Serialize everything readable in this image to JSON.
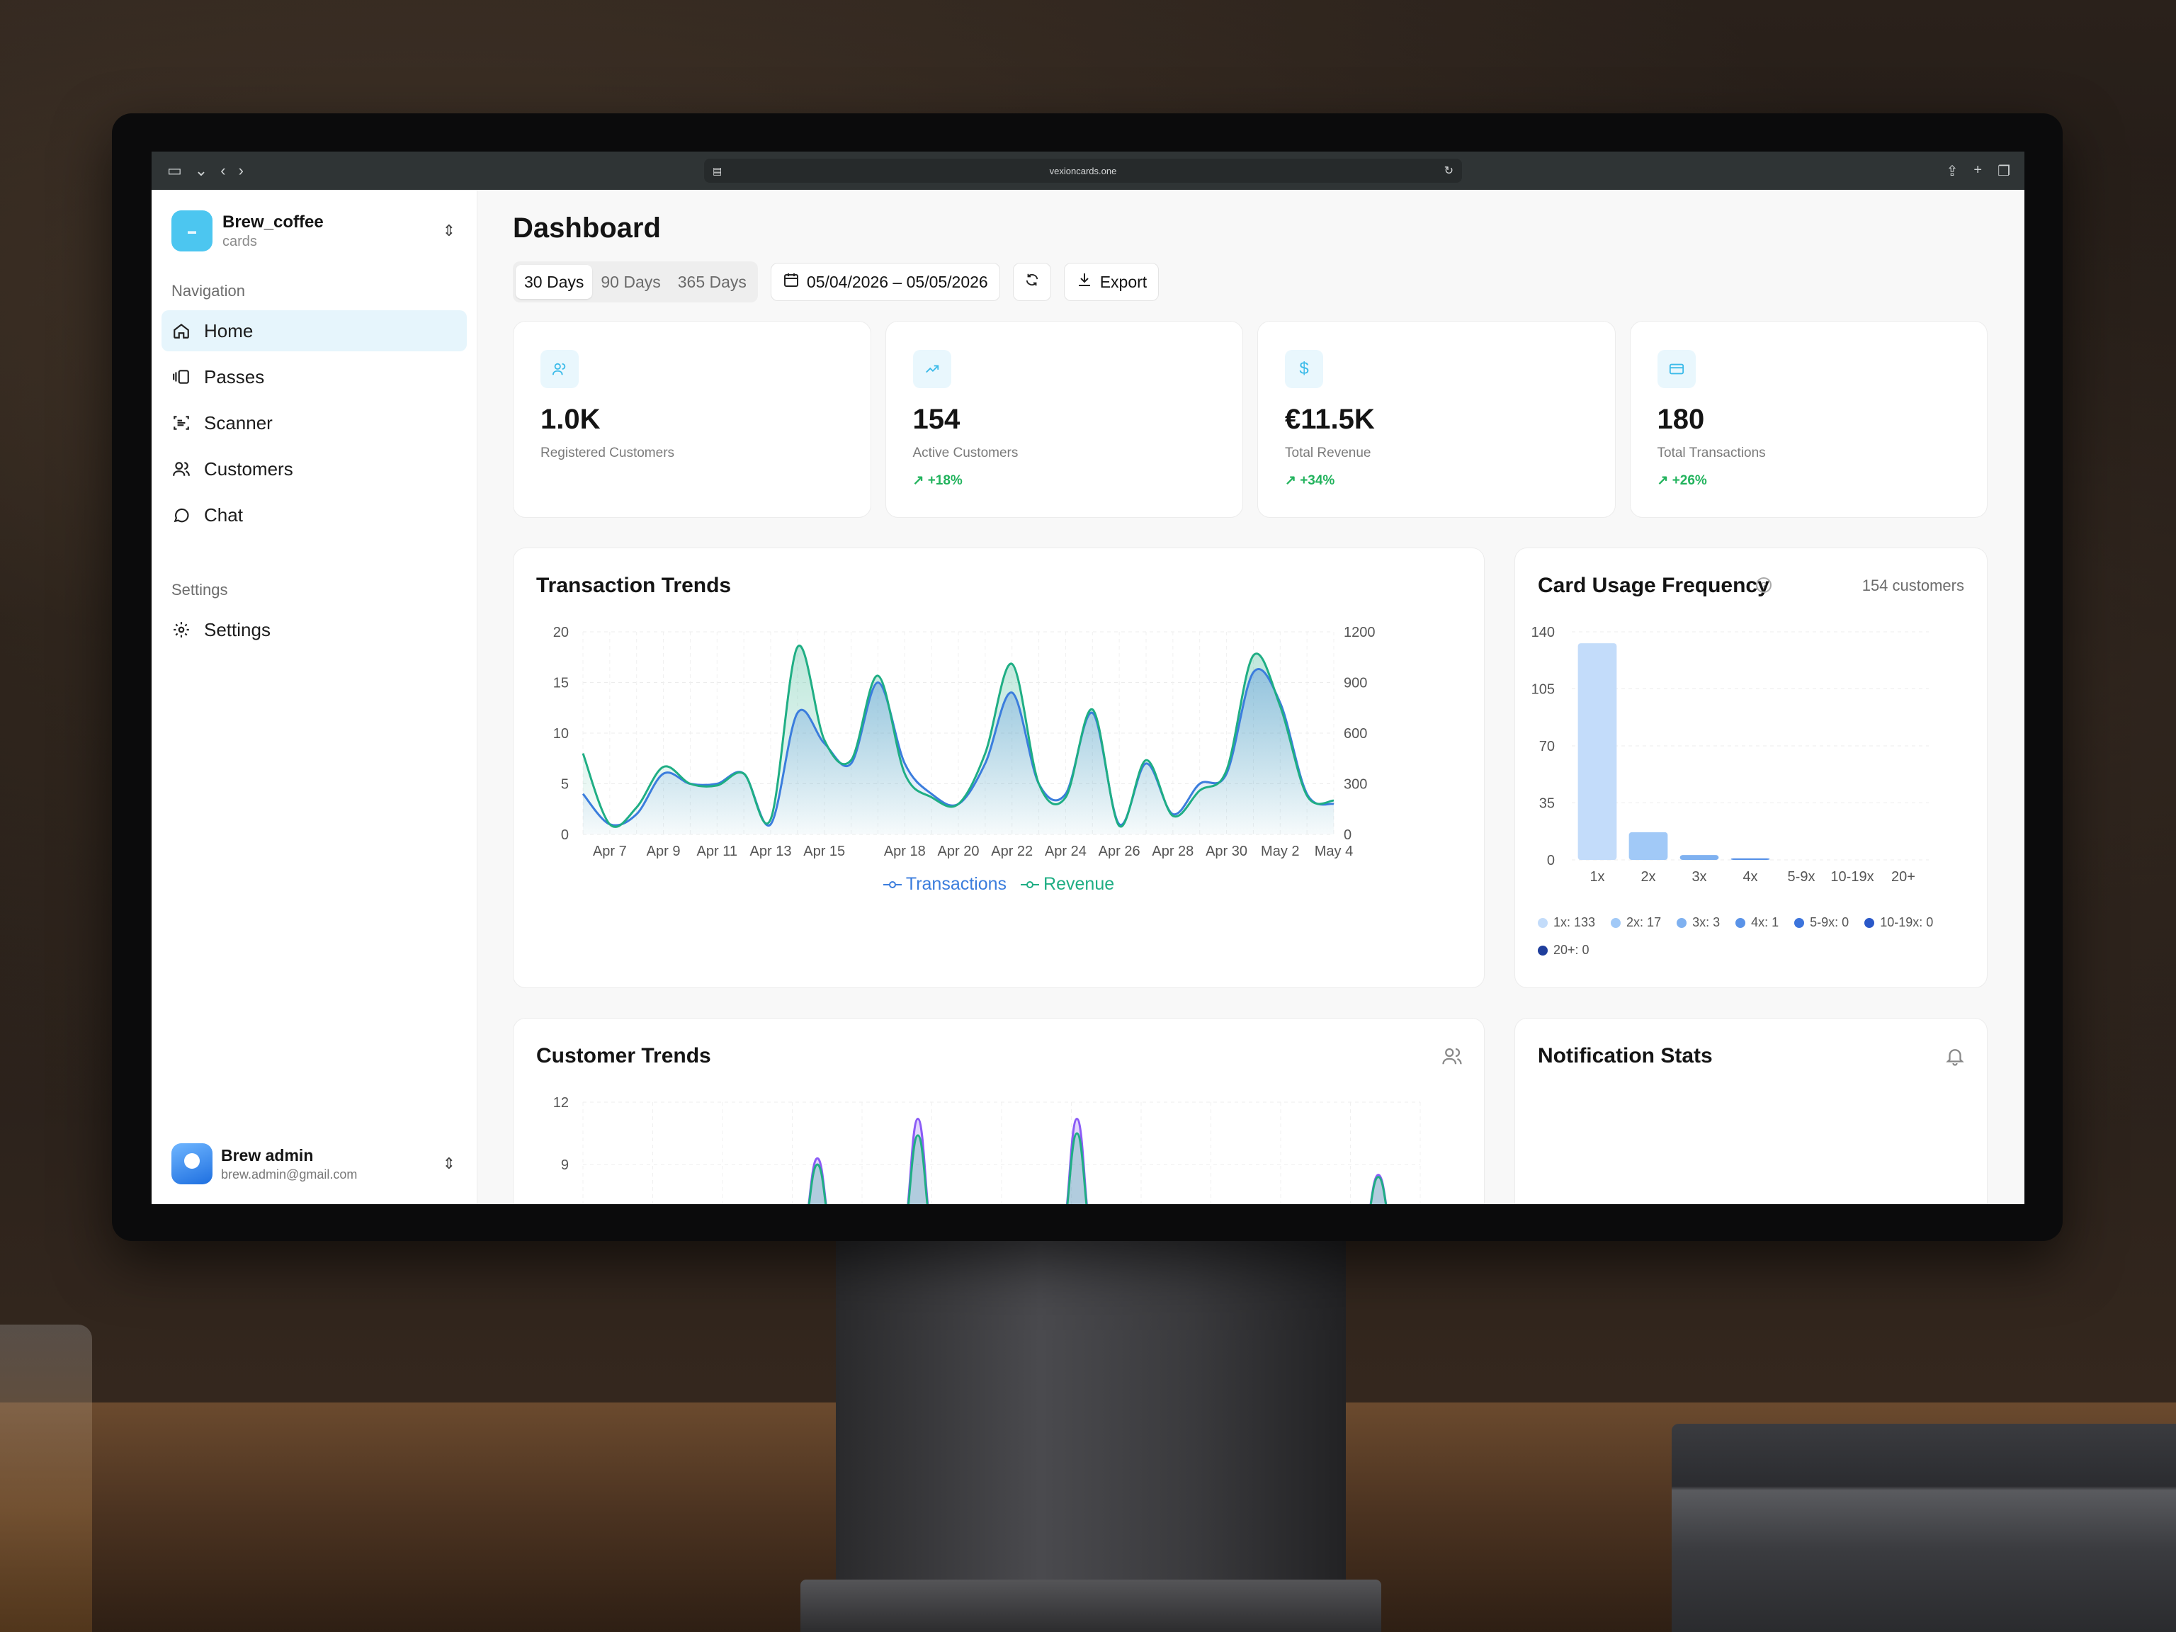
{
  "browser": {
    "url": "vexioncards.one"
  },
  "org": {
    "name": "Brew_coffee",
    "sub": "cards"
  },
  "nav": {
    "section": "Navigation",
    "items": [
      {
        "label": "Home",
        "icon": "home-icon"
      },
      {
        "label": "Passes",
        "icon": "passes-icon"
      },
      {
        "label": "Scanner",
        "icon": "scanner-icon"
      },
      {
        "label": "Customers",
        "icon": "users-icon"
      },
      {
        "label": "Chat",
        "icon": "chat-icon"
      }
    ],
    "settings_section": "Settings",
    "settings_item": "Settings"
  },
  "user": {
    "name": "Brew admin",
    "email": "brew.admin@gmail.com"
  },
  "page": {
    "title": "Dashboard"
  },
  "toolbar": {
    "ranges": [
      "30 Days",
      "90 Days",
      "365 Days"
    ],
    "date_range": "05/04/2026 – 05/05/2026",
    "export": "Export"
  },
  "stats": [
    {
      "value": "1.0K",
      "label": "Registered Customers",
      "trend": ""
    },
    {
      "value": "154",
      "label": "Active Customers",
      "trend": "+18%"
    },
    {
      "value": "€11.5K",
      "label": "Total Revenue",
      "trend": "+34%"
    },
    {
      "value": "180",
      "label": "Total Transactions",
      "trend": "+26%"
    }
  ],
  "colors": {
    "accent": "#3cbbe9",
    "transactions": "#3b7ddd",
    "revenue": "#1fae84",
    "purple": "#8b5cf6",
    "positive": "#22b35d"
  },
  "transaction_trends": {
    "title": "Transaction Trends"
  },
  "card_usage": {
    "title": "Card Usage Frequency",
    "subtitle": "154 customers"
  },
  "customer_trends": {
    "title": "Customer Trends"
  },
  "notification_stats": {
    "title": "Notification Stats"
  },
  "chart_data": [
    {
      "type": "area",
      "title": "Transaction Trends",
      "x": [
        "Apr 6",
        "Apr 7",
        "Apr 8",
        "Apr 9",
        "Apr 10",
        "Apr 11",
        "Apr 12",
        "Apr 13",
        "Apr 14",
        "Apr 15",
        "Apr 16",
        "Apr 17",
        "Apr 18",
        "Apr 19",
        "Apr 20",
        "Apr 21",
        "Apr 22",
        "Apr 23",
        "Apr 24",
        "Apr 25",
        "Apr 26",
        "Apr 27",
        "Apr 28",
        "Apr 29",
        "Apr 30",
        "May 1",
        "May 2",
        "May 3",
        "May 4"
      ],
      "xticks": [
        "Apr 7",
        "Apr 9",
        "Apr 11",
        "Apr 13",
        "Apr 15",
        "Apr 18",
        "Apr 20",
        "Apr 22",
        "Apr 24",
        "Apr 26",
        "Apr 28",
        "Apr 30",
        "May 2",
        "May 4"
      ],
      "series": [
        {
          "name": "Transactions",
          "axis": "left",
          "values": [
            4,
            1,
            2,
            6,
            5,
            5,
            6,
            1,
            12,
            9,
            7,
            15,
            7,
            4,
            3,
            7,
            14,
            5,
            4,
            12,
            1,
            7,
            2,
            5,
            6,
            16,
            13,
            4,
            3
          ]
        },
        {
          "name": "Revenue",
          "axis": "right",
          "values": [
            480,
            60,
            160,
            400,
            300,
            290,
            360,
            90,
            1110,
            560,
            440,
            940,
            360,
            220,
            180,
            480,
            1010,
            300,
            220,
            740,
            50,
            440,
            110,
            260,
            380,
            1060,
            760,
            230,
            200
          ]
        }
      ],
      "ylim_left": [
        0,
        20
      ],
      "yticks_left": [
        0,
        5,
        10,
        15,
        20
      ],
      "ylim_right": [
        0,
        1200
      ],
      "yticks_right": [
        0,
        300,
        600,
        900,
        1200
      ],
      "legend": "bottom-center"
    },
    {
      "type": "bar",
      "title": "Card Usage Frequency",
      "categories": [
        "1x",
        "2x",
        "3x",
        "4x",
        "5-9x",
        "10-19x",
        "20+"
      ],
      "values": [
        133,
        17,
        3,
        1,
        0,
        0,
        0
      ],
      "ylim": [
        0,
        140
      ],
      "yticks": [
        0,
        35,
        70,
        105,
        140
      ],
      "legend_labels": [
        "1x: 133",
        "2x: 17",
        "3x: 3",
        "4x: 1",
        "5-9x: 0",
        "10-19x: 0",
        "20+: 0"
      ],
      "colors": [
        "#c3dcfa",
        "#a1c9f7",
        "#7fb1f0",
        "#5a93e8",
        "#3c74dc",
        "#2a58c8",
        "#1f3e9c"
      ]
    },
    {
      "type": "area",
      "title": "Customer Trends",
      "yticks": [
        9,
        12
      ],
      "ylim": [
        0,
        12
      ],
      "partially_visible": true,
      "series": [
        {
          "name": "",
          "color": "#8b5cf6",
          "peaks": [
            [
              0.28,
              9.3
            ],
            [
              0.4,
              11.2
            ],
            [
              0.59,
              11.2
            ],
            [
              0.95,
              8.5
            ]
          ]
        },
        {
          "name": "",
          "color": "#1fae84",
          "peaks": [
            [
              0.28,
              9.0
            ],
            [
              0.4,
              10.4
            ],
            [
              0.59,
              10.5
            ],
            [
              0.95,
              8.4
            ]
          ]
        }
      ]
    }
  ]
}
